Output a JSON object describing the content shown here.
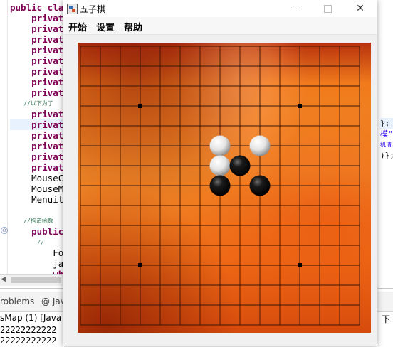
{
  "ide": {
    "code_lines": [
      {
        "text": "public clas",
        "kind": "keyword"
      },
      {
        "text": "    private",
        "kind": "keyword"
      },
      {
        "text": "    private",
        "kind": "keyword"
      },
      {
        "text": "    private",
        "kind": "keyword"
      },
      {
        "text": "    private",
        "kind": "keyword"
      },
      {
        "text": "    private",
        "kind": "keyword"
      },
      {
        "text": "    private",
        "kind": "keyword"
      },
      {
        "text": "    private",
        "kind": "keyword"
      },
      {
        "text": "    private",
        "kind": "keyword"
      },
      {
        "text": "    //以下为了",
        "kind": "comment"
      },
      {
        "text": "    private",
        "kind": "keyword"
      },
      {
        "text": "    private",
        "kind": "keyword"
      },
      {
        "text": "    private",
        "kind": "keyword"
      },
      {
        "text": "    private",
        "kind": "keyword"
      },
      {
        "text": "    private",
        "kind": "keyword"
      },
      {
        "text": "    private",
        "kind": "keyword"
      },
      {
        "text": "    MouseCl",
        "kind": "plain"
      },
      {
        "text": "    MouseMo",
        "kind": "plain"
      },
      {
        "text": "    Menuite",
        "kind": "plain"
      },
      {
        "text": "",
        "kind": "plain"
      },
      {
        "text": "    //构造函数",
        "kind": "comment"
      },
      {
        "text": "    public ",
        "kind": "keyword"
      },
      {
        "text": "        //",
        "kind": "comment"
      },
      {
        "text": "        For",
        "kind": "plain"
      },
      {
        "text": "        jav",
        "kind": "plain"
      },
      {
        "text": "        whi",
        "kind": "keyword"
      }
    ],
    "right_fragments": [
      {
        "text": "};",
        "kind": "plain"
      },
      {
        "text": "模\"",
        "kind": "str"
      },
      {
        "text": "机请",
        "kind": "small"
      },
      {
        "text": ")};",
        "kind": "plain"
      }
    ],
    "fold_marker": "⊖",
    "hscroll_arrow": "◀",
    "tabs": {
      "problems": "roblems",
      "javadoc": "@ Jav"
    },
    "console_title": "sMap (1) [Java A",
    "console_lines": [
      "22222222222",
      "22222222222"
    ],
    "right_bottom_text": "下"
  },
  "window": {
    "title": "五子棋",
    "controls": {
      "minimize": "",
      "maximize": "",
      "close": "✕"
    },
    "menu": [
      "开始",
      "设置",
      "帮助"
    ]
  },
  "board": {
    "grid_size": 15,
    "line_color": "#3a1608",
    "star_points": [
      [
        3,
        3
      ],
      [
        11,
        3
      ],
      [
        3,
        11
      ],
      [
        11,
        11
      ]
    ],
    "stones": [
      {
        "col": 7,
        "row": 5,
        "color": "white"
      },
      {
        "col": 9,
        "row": 5,
        "color": "white"
      },
      {
        "col": 7,
        "row": 6,
        "color": "white"
      },
      {
        "col": 8,
        "row": 6,
        "color": "black"
      },
      {
        "col": 7,
        "row": 7,
        "color": "black"
      },
      {
        "col": 9,
        "row": 7,
        "color": "black"
      }
    ]
  },
  "colors": {
    "keyword": "#7f0055",
    "comment": "#3f7f5f",
    "string": "#2a00ff"
  }
}
